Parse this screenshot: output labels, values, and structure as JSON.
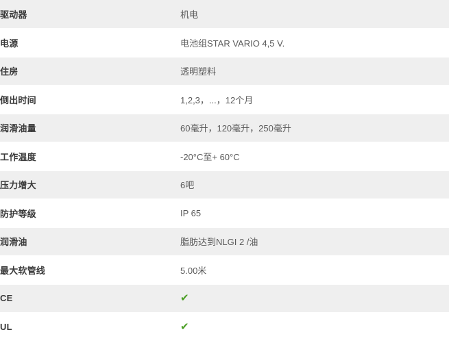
{
  "table": {
    "name": "product-specifications",
    "columns": [
      "property",
      "value"
    ],
    "rows": [
      {
        "label": "驱动器",
        "value": "机电",
        "type": "text",
        "shaded": true
      },
      {
        "label": "电源",
        "value": "电池组STAR VARIO 4,5 V.",
        "type": "text",
        "shaded": false
      },
      {
        "label": "住房",
        "value": "透明塑料",
        "type": "text",
        "shaded": true
      },
      {
        "label": "倒出时间",
        "value": "1,2,3，...，12个月",
        "type": "text",
        "shaded": false
      },
      {
        "label": "润滑油量",
        "value": "60毫升，120毫升，250毫升",
        "type": "text",
        "shaded": true
      },
      {
        "label": "工作温度",
        "value": "-20°C至+ 60°C",
        "type": "text",
        "shaded": false
      },
      {
        "label": "压力增大",
        "value": "6吧",
        "type": "text",
        "shaded": true
      },
      {
        "label": "防护等级",
        "value": "IP 65",
        "type": "text",
        "shaded": false
      },
      {
        "label": "润滑油",
        "value": "脂肪达到NLGI 2 /油",
        "type": "text",
        "shaded": true
      },
      {
        "label": "最大软管线",
        "value": "5.00米",
        "type": "text",
        "shaded": false
      },
      {
        "label": "CE",
        "value": "✔",
        "type": "check",
        "shaded": true
      },
      {
        "label": "UL",
        "value": "✔",
        "type": "check",
        "shaded": false
      }
    ]
  },
  "colors": {
    "row_shaded_bg": "#efefef",
    "row_plain_bg": "#ffffff",
    "label_text": "#3a3a3a",
    "value_text": "#5a5a5a",
    "check_green": "#4a9e23",
    "divider": "#ffffff"
  },
  "icons": {
    "check": "check-mark-icon"
  }
}
